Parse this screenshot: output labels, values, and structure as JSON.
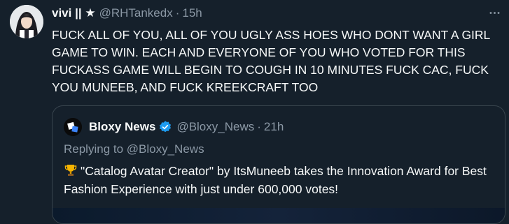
{
  "author": {
    "display_name": "vivi || ★",
    "handle": "@RHTankedx",
    "dot": "·",
    "time": "15h"
  },
  "tweet": {
    "text": "FUCK ALL OF YOU, ALL OF YOU UGLY ASS HOES WHO DONT WANT A GIRL\nGAME TO WIN. EACH AND EVERYONE OF YOU WHO VOTED FOR THIS\nFUCKASS GAME WILL BEGIN TO COUGH IN 10 MINUTES FUCK CAC, FUCK\nYOU MUNEEB, AND FUCK KREEKCRAFT TOO"
  },
  "quote": {
    "display_name": "Bloxy News",
    "handle": "@Bloxy_News",
    "dot": "·",
    "time": "21h",
    "replying_to": "Replying to @Bloxy_News",
    "text": "\"Catalog Avatar Creator\" by ItsMuneeb takes the Innovation Award for Best Fashion Experience with just under 600,000 votes!"
  },
  "icons": {
    "more": "more-horizontal-icon",
    "verified": "verified-badge-icon",
    "trophy": "trophy-emoji"
  },
  "colors": {
    "background": "#15202b",
    "secondary_text": "#8b98a5",
    "border": "#38444d",
    "verified_blue": "#1d9bf0"
  }
}
